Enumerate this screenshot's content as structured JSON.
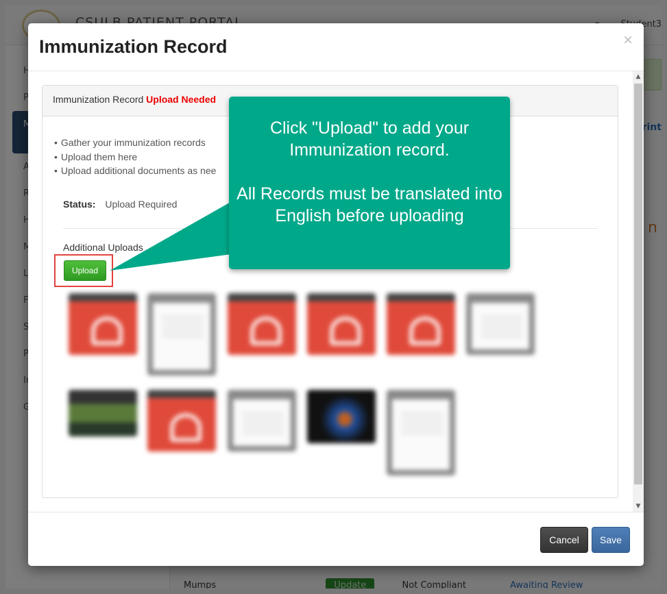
{
  "background": {
    "portal_title": "CSULB PATIENT PORTAL",
    "user_name": "Student3",
    "sidebar_items": [
      "H",
      "P",
      "M",
      "A",
      "R",
      "H",
      "M",
      "L",
      "F",
      "S",
      "P",
      "In",
      "G"
    ],
    "print_link": "rint",
    "orange_fragment": "n",
    "row": {
      "label": "Mumps",
      "update": "Update",
      "status": "Not Compliant",
      "review": "Awaiting Review"
    }
  },
  "modal": {
    "title": "Immunization Record",
    "close": "×",
    "panel": {
      "heading": "Immunization Record",
      "heading_status": "Upload Needed",
      "bullets": [
        "Gather your immunization records",
        "Upload them here",
        "Upload additional documents as nee"
      ],
      "status_label": "Status:",
      "status_value": "Upload Required",
      "additional_uploads": "Additional Uploads",
      "upload_button": "Upload",
      "thumbnails": [
        "pdf",
        "document",
        "pdf",
        "pdf",
        "pdf",
        "document",
        "photo",
        "pdf",
        "document",
        "photo",
        "document"
      ]
    },
    "footer": {
      "cancel": "Cancel",
      "save": "Save"
    }
  },
  "callout": {
    "line1": "Click \"Upload\" to add your Immunization record.",
    "line2": "All Records must be translated into English before uploading",
    "color": "#00A88A"
  },
  "colors": {
    "upload_needed": "#EE0000",
    "upload_button": "#3FAE2F",
    "highlight_box": "#E4423F",
    "save_button": "#4573AB"
  }
}
